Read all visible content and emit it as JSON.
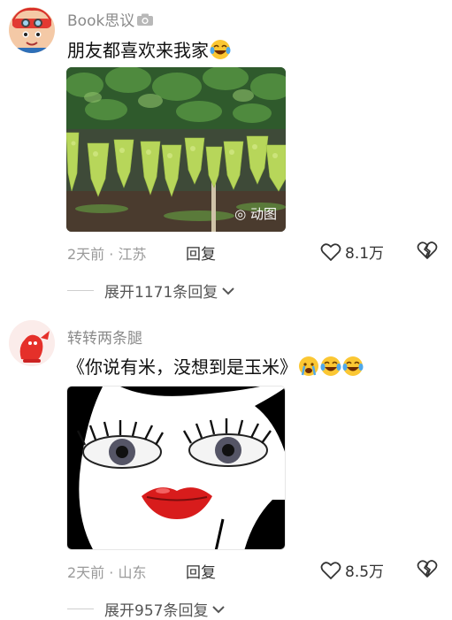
{
  "comments": [
    {
      "username": "Book思议",
      "username_badge": "camera-icon",
      "text": "朋友都喜欢来我家",
      "emojis": [
        "laugh-cry-emoji"
      ],
      "media_tag": "动图",
      "time": "2天前",
      "location": "江苏",
      "reply_label": "回复",
      "likes": "8.1万",
      "expand_label": "展开1171条回复"
    },
    {
      "username": "转转两条腿",
      "text": "《你说有米，没想到是玉米》",
      "emojis": [
        "crying-emoji",
        "laugh-cry-emoji",
        "laugh-cry-emoji"
      ],
      "time": "2天前",
      "location": "山东",
      "reply_label": "回复",
      "likes": "8.5万",
      "expand_label": "展开957条回复"
    }
  ],
  "colors": {
    "username": "#8a8a8a",
    "meta": "#9a9a9a",
    "grape": "#b7d65a"
  }
}
